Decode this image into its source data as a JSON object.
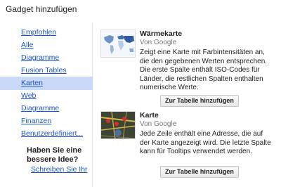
{
  "dialog": {
    "title": "Gadget hinzufügen"
  },
  "sidebar": {
    "items": [
      {
        "label": "Empfohlen",
        "active": false
      },
      {
        "label": "Alle",
        "active": false
      },
      {
        "label": "Diagramme",
        "active": false
      },
      {
        "label": "Fusion Tables",
        "active": false
      },
      {
        "label": "Karten",
        "active": true
      },
      {
        "label": "Web",
        "active": false
      },
      {
        "label": "Diagramme",
        "active": false
      },
      {
        "label": "Finanzen",
        "active": false
      },
      {
        "label": "Benutzerdefiniert...",
        "active": false
      }
    ],
    "idea_heading": "Haben Sie eine bessere Idee?",
    "idea_link": "Schreiben Sie Ihr"
  },
  "gadgets": [
    {
      "title": "Wärmekarte",
      "author": "Von Google",
      "description": "Zeigt eine Karte mit Farbintensitäten an, die den gegebenen Werten entsprechen. Die erste Spalte enthält ISO-Codes für Länder, die restlichen Spalten enthalten numerische Werte.",
      "button": "Zur Tabelle hinzufügen",
      "thumbnail": "world-heatmap"
    },
    {
      "title": "Karte",
      "author": "Von Google",
      "description": "Jede Zeile enthält eine Adresse, die auf der Karte angezeigt wird. Die letzte Spalte kann für Tooltips verwendet werden.",
      "button": "Zur Tabelle hinzufügen",
      "thumbnail": "map-pins"
    }
  ],
  "colors": {
    "link": "#1a55cc",
    "active_bg": "#c9daf8",
    "heatmap": "#3e6fb0",
    "pin": "#d93025"
  }
}
